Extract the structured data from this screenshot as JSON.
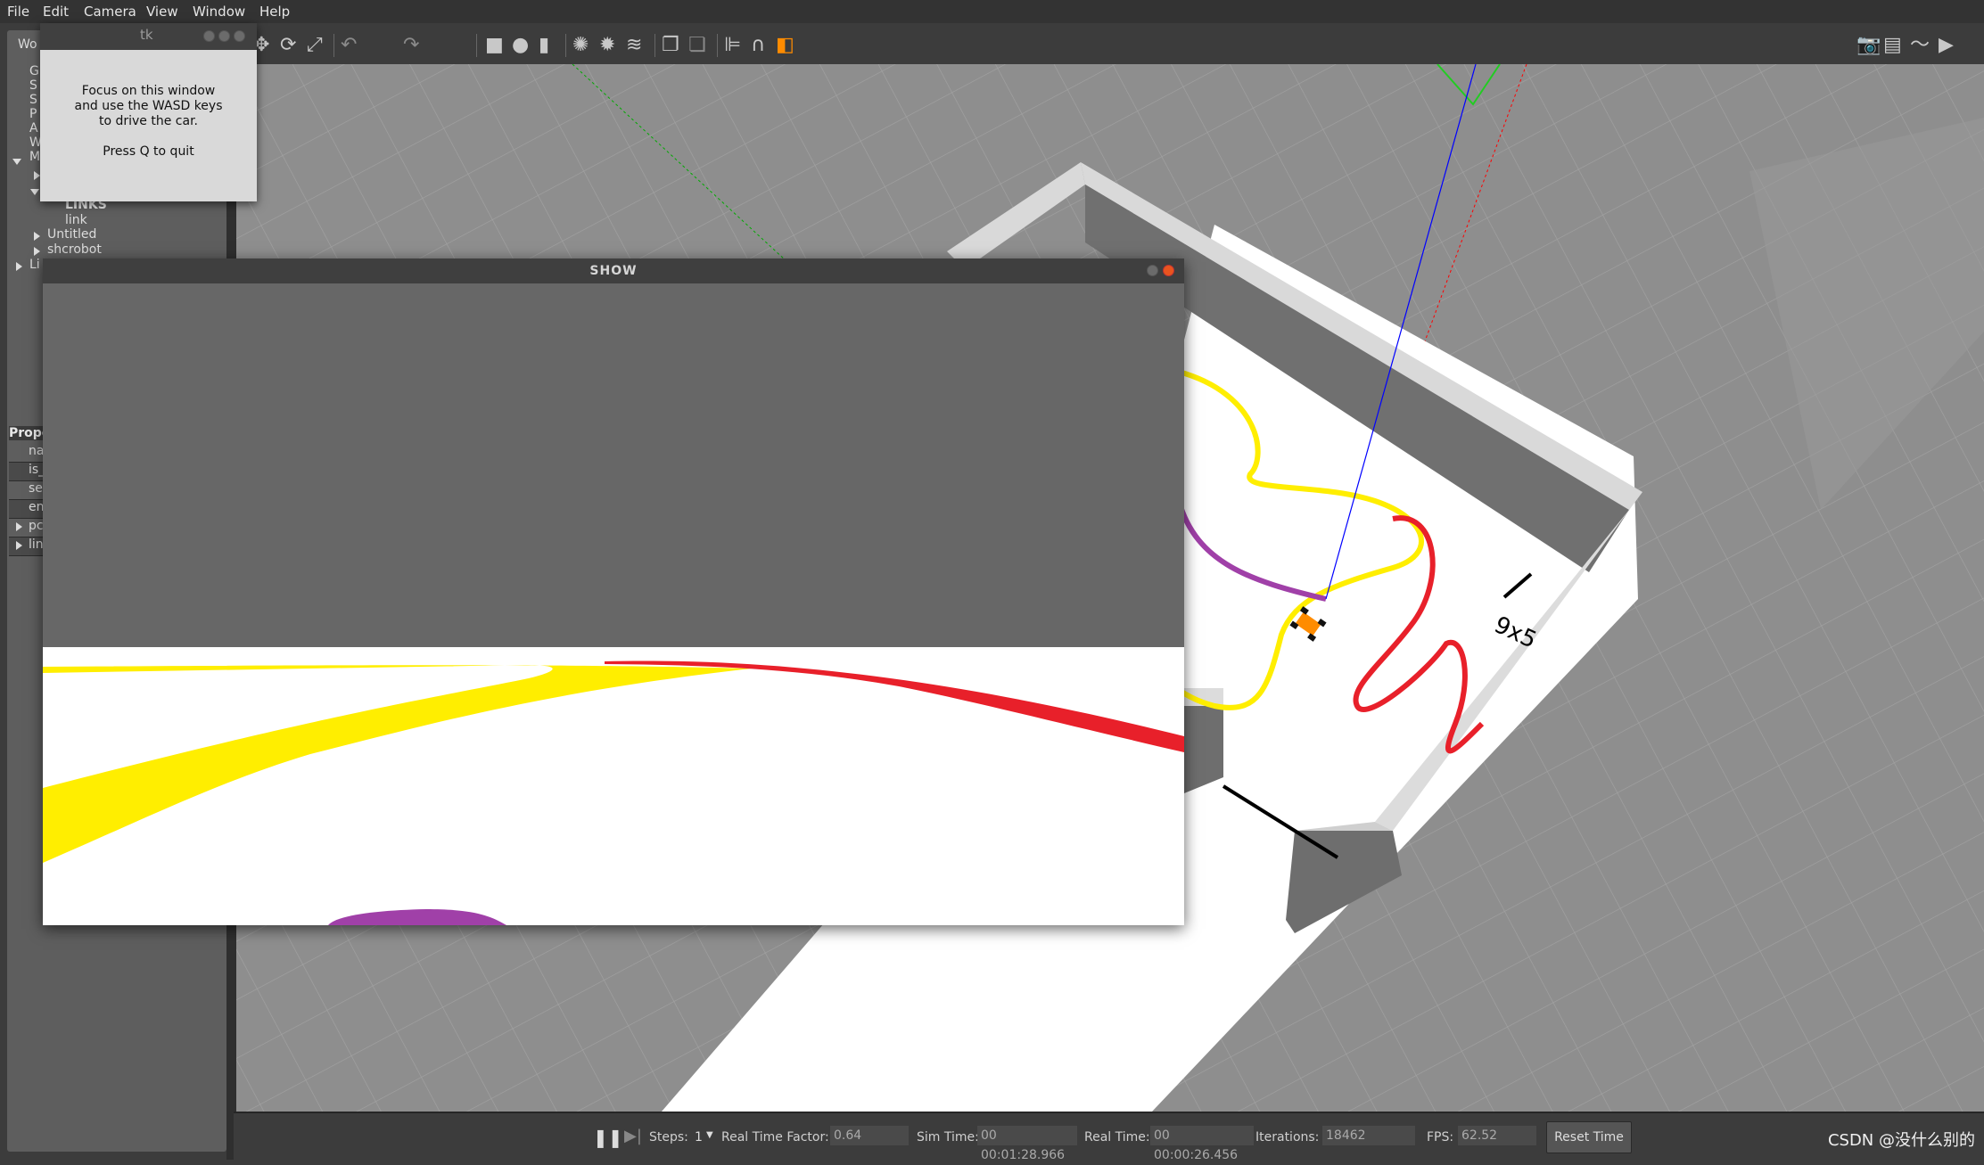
{
  "menu": [
    "File",
    "Edit",
    "Camera",
    "View",
    "Window",
    "Help"
  ],
  "left_panel": {
    "world_tab": "Wo",
    "tree_items": [
      "G",
      "S",
      "S",
      "P",
      "A",
      "W",
      "M"
    ],
    "links_header": "LINKS",
    "link_item": "link",
    "models": [
      "Untitled",
      "shcrobot"
    ],
    "last_item": "Li",
    "properties_header": "Prope",
    "property_rows": [
      "na",
      "is_",
      "se",
      "en",
      "pc",
      "lin"
    ]
  },
  "tk_window": {
    "title": "tk",
    "line1": "Focus on this window",
    "line2": "and use the WASD keys",
    "line3": "to drive the car.",
    "line4": "Press Q to quit"
  },
  "show_window": {
    "title": "SHOW"
  },
  "scene": {
    "board_text": "9x5"
  },
  "bottom_bar": {
    "steps_label": "Steps:",
    "steps_value": "1",
    "rtf_label": "Real Time Factor:",
    "rtf_value": "0.64",
    "sim_label": "Sim Time:",
    "sim_value": "00 00:01:28.966",
    "real_label": "Real Time:",
    "real_value": "00 00:00:26.456",
    "iter_label": "Iterations:",
    "iter_value": "18462",
    "fps_label": "FPS:",
    "fps_value": "62.52",
    "reset_label": "Reset Time"
  },
  "watermark": "CSDN @没什么别的",
  "colors": {
    "ground": "#8e8e8e",
    "track_yellow": "#ffee00",
    "track_red": "#e8202a",
    "track_purple": "#a040a8",
    "robot": "#ff8c00"
  }
}
